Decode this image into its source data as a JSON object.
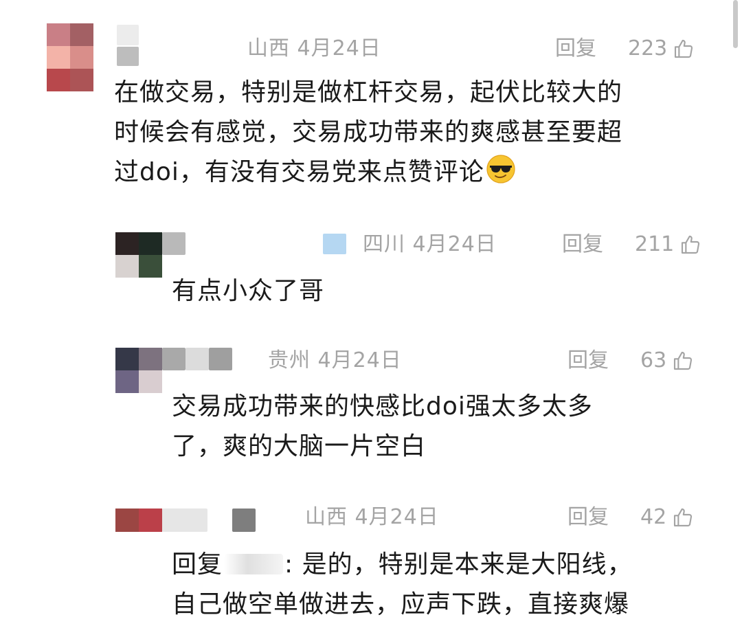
{
  "comments": [
    {
      "region": "山西",
      "date": "4月24日",
      "reply_label": "回复",
      "likes": "223",
      "lines": [
        "在做交易，特别是做杠杆交易，起伏比较大的",
        "时候会有感觉，交易成功带来的爽感甚至要超",
        "过doi，有没有交易党来点赞评论"
      ],
      "emoji": "sunglasses-emoji"
    },
    {
      "region": "四川",
      "date": "4月24日",
      "reply_label": "回复",
      "likes": "211",
      "lines": [
        "有点小众了哥"
      ]
    },
    {
      "region": "贵州",
      "date": "4月24日",
      "reply_label": "回复",
      "likes": "63",
      "lines": [
        "交易成功带来的快感比doi强太多太多",
        "了，爽的大脑一片空白"
      ]
    },
    {
      "region": "山西",
      "date": "4月24日",
      "reply_label": "回复",
      "likes": "42",
      "line1_prefix": "回复",
      "line1_suffix": ": 是的，特别是本来是大阳线，",
      "lines": [
        "自己做空单做进去，应声下跌，直接爽爆"
      ]
    }
  ],
  "icons": {
    "like": "thumbs-up-icon"
  },
  "colors": {
    "meta_text": "#a4a4a4",
    "body_text": "#1a1a1a",
    "background": "#ffffff"
  }
}
